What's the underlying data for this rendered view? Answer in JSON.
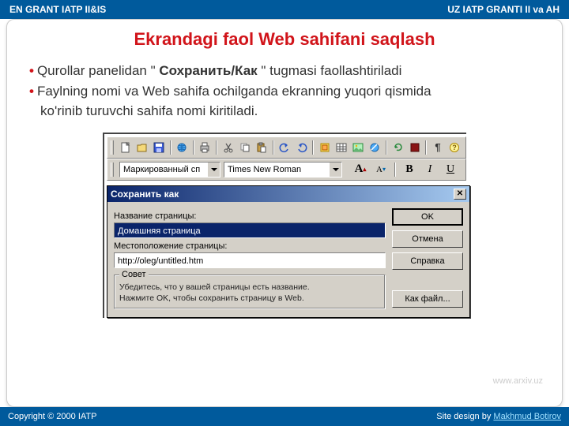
{
  "header": {
    "left": "EN GRANT IATP II&IS",
    "right": "UZ  IATP GRANTI II va AH"
  },
  "title": "Ekrandagi faol  Web sahifani saqlash",
  "bullets": {
    "line1a": "Qurollar panelidan \" ",
    "line1b": "Сохранить/Как",
    "line1c": " \" tugmasi faollashtiriladi",
    "line2": "Faylning nomi va Web sahifa ochilganda ekranning yuqori qismida",
    "line3": "ko'rinib turuvchi sahifa nomi kiritiladi."
  },
  "format_bar": {
    "style": "Маркированный сп",
    "font": "Times New Roman",
    "btn_big_a": "A",
    "btn_small_a": "A",
    "btn_bold": "B",
    "btn_italic": "I",
    "btn_under": "U"
  },
  "dialog": {
    "title": "Сохранить как",
    "label_name": "Название страницы:",
    "val_name": "Домашняя страница",
    "label_loc": "Местоположение страницы:",
    "val_loc": "http://oleg/untitled.htm",
    "btn_ok": "OK",
    "btn_cancel": "Отмена",
    "btn_help": "Справка",
    "btn_asfile": "Как файл...",
    "hint_legend": "Совет",
    "hint1": "Убедитесь, что у вашей страницы есть название.",
    "hint2": "Нажмите OK, чтобы сохранить страницу в Web."
  },
  "watermark": "www.arxiv.uz",
  "footer": {
    "copyright": "Copyright © 2000 IATP",
    "design_prefix": "Site design by ",
    "designer": "Makhmud Botirov"
  }
}
